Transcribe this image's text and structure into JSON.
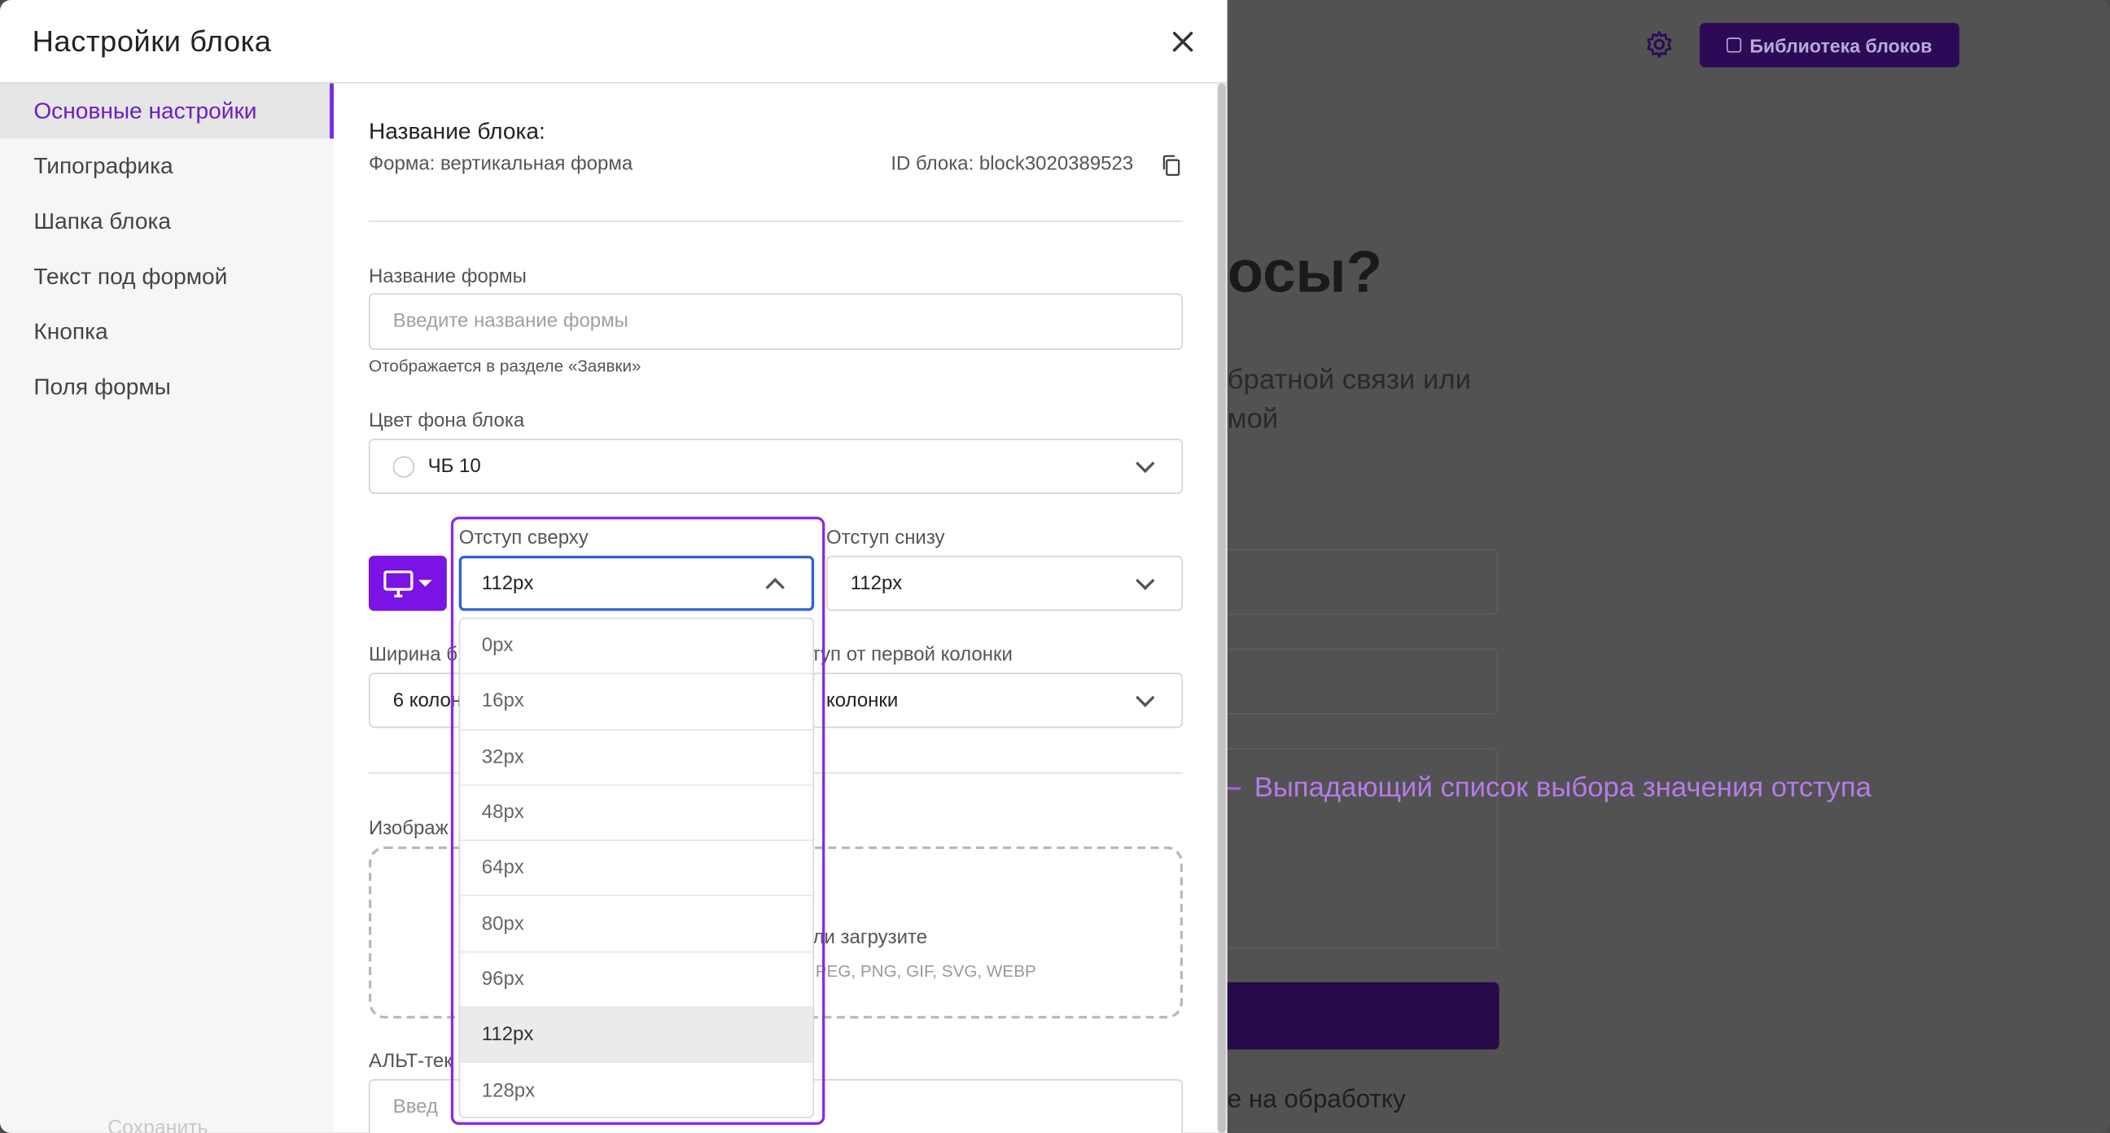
{
  "background": {
    "library_button": "Библиотека блоков",
    "headline": "осы?",
    "subtext_line1": "братной связи или",
    "subtext_line2": "мой",
    "note": "е на обработку"
  },
  "annotation": {
    "text": "Выпадающий список выбора значения отступа",
    "color": "#a35ee6"
  },
  "modal": {
    "title": "Настройки блока",
    "sidebar": {
      "items": [
        {
          "label": "Основные настройки",
          "active": true
        },
        {
          "label": "Типографика",
          "active": false
        },
        {
          "label": "Шапка блока",
          "active": false
        },
        {
          "label": "Текст под формой",
          "active": false
        },
        {
          "label": "Кнопка",
          "active": false
        },
        {
          "label": "Поля формы",
          "active": false
        }
      ],
      "save_label": "Сохранить"
    },
    "block_name_label": "Название блока:",
    "form_type": "Форма: вертикальная форма",
    "block_id": "ID блока: block3020389523",
    "form_name": {
      "label": "Название формы",
      "placeholder": "Введите название формы",
      "hint": "Отображается в разделе «Заявки»"
    },
    "bg_color": {
      "label": "Цвет фона блока",
      "value": "ЧБ 10"
    },
    "padding_top": {
      "label": "Отступ сверху",
      "value": "112px",
      "options": [
        "0px",
        "16px",
        "32px",
        "48px",
        "64px",
        "80px",
        "96px",
        "112px",
        "128px"
      ],
      "selected": "112px"
    },
    "padding_bottom": {
      "label": "Отступ снизу",
      "value": "112px"
    },
    "width": {
      "label": "Ширина б",
      "value": "6 колон"
    },
    "offset": {
      "label": "туп от первой колонки",
      "value": "колонки"
    },
    "image": {
      "label": "Изображ",
      "upload_text": "ли загрузите",
      "formats": "PEG, PNG, GIF, SVG, WEBP"
    },
    "alt": {
      "label": "АЛЬТ-тек",
      "placeholder": "Введ"
    },
    "accent_color": "#7b12e6"
  }
}
